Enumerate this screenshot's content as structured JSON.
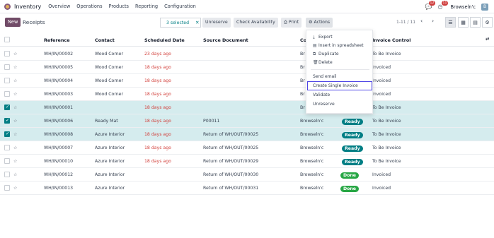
{
  "nav": {
    "app_name": "Inventory",
    "menu": [
      "Overview",
      "Operations",
      "Products",
      "Reporting",
      "Configuration"
    ],
    "chat_count": "12",
    "activity_count": "11",
    "company": "Browseln'c",
    "avatar_letter": "B"
  },
  "control": {
    "new_label": "New",
    "breadcrumb": "Receipts",
    "selected_text": "3 selected",
    "unreserve_label": "Unreserve",
    "check_availability_label": "Check Availability",
    "print_label": "Print",
    "actions_label": "Actions",
    "pager": "1-11 / 11"
  },
  "table": {
    "columns": {
      "reference": "Reference",
      "contact": "Contact",
      "scheduled": "Scheduled Date",
      "source": "Source Document",
      "company": "Co",
      "invoice": "Invoice Control"
    },
    "rows": [
      {
        "selected": false,
        "reference": "WH/IN/00002",
        "contact": "Wood Corner",
        "scheduled": "23 days ago",
        "source": "",
        "company": "Br",
        "status": "",
        "invoice": "To Be Invoice"
      },
      {
        "selected": false,
        "reference": "WH/IN/00005",
        "contact": "Wood Corner",
        "scheduled": "18 days ago",
        "source": "",
        "company": "Br",
        "status": "",
        "invoice": "Invoiced"
      },
      {
        "selected": false,
        "reference": "WH/IN/00004",
        "contact": "Wood Corner",
        "scheduled": "18 days ago",
        "source": "",
        "company": "Br",
        "status": "",
        "invoice": "Invoiced"
      },
      {
        "selected": false,
        "reference": "WH/IN/00003",
        "contact": "Wood Corner",
        "scheduled": "18 days ago",
        "source": "",
        "company": "Br",
        "status": "",
        "invoice": "Invoiced"
      },
      {
        "selected": true,
        "reference": "WH/IN/00001",
        "contact": "",
        "scheduled": "18 days ago",
        "source": "",
        "company": "Br",
        "status": "",
        "invoice": "To Be Invoice"
      },
      {
        "selected": true,
        "reference": "WH/IN/00006",
        "contact": "Ready Mat",
        "scheduled": "18 days ago",
        "source": "P00011",
        "company": "Browseln'c",
        "status": "Ready",
        "invoice": "To Be Invoice"
      },
      {
        "selected": true,
        "reference": "WH/IN/00008",
        "contact": "Azure Interior",
        "scheduled": "18 days ago",
        "source": "Return of WH/OUT/00025",
        "company": "Browseln'c",
        "status": "Ready",
        "invoice": "To Be Invoice"
      },
      {
        "selected": false,
        "reference": "WH/IN/00007",
        "contact": "Azure Interior",
        "scheduled": "18 days ago",
        "source": "Return of WH/OUT/00025",
        "company": "Browseln'c",
        "status": "Ready",
        "invoice": "To Be Invoice"
      },
      {
        "selected": false,
        "reference": "WH/IN/00010",
        "contact": "Azure Interior",
        "scheduled": "18 days ago",
        "source": "Return of WH/OUT/00029",
        "company": "Browseln'c",
        "status": "Ready",
        "invoice": "To Be Invoice"
      },
      {
        "selected": false,
        "reference": "WH/IN/00012",
        "contact": "Azure Interior",
        "scheduled": "",
        "source": "Return of WH/OUT/00030",
        "company": "Browseln'c",
        "status": "Done",
        "invoice": "Invoiced"
      },
      {
        "selected": false,
        "reference": "WH/IN/00013",
        "contact": "Azure Interior",
        "scheduled": "",
        "source": "Return of WH/OUT/00031",
        "company": "Browseln'c",
        "status": "Done",
        "invoice": "Invoiced"
      }
    ]
  },
  "actions_menu": {
    "export": "Export",
    "insert_spreadsheet": "Insert in spreadsheet",
    "duplicate": "Duplicate",
    "delete": "Delete",
    "send_email": "Send email",
    "create_single_invoice": "Create Single Invoice",
    "validate": "Validate",
    "unreserve": "Unreserve"
  },
  "colors": {
    "brand": "#714b67",
    "accent": "#017e84",
    "overdue": "#d23f3a",
    "done": "#28a745"
  }
}
